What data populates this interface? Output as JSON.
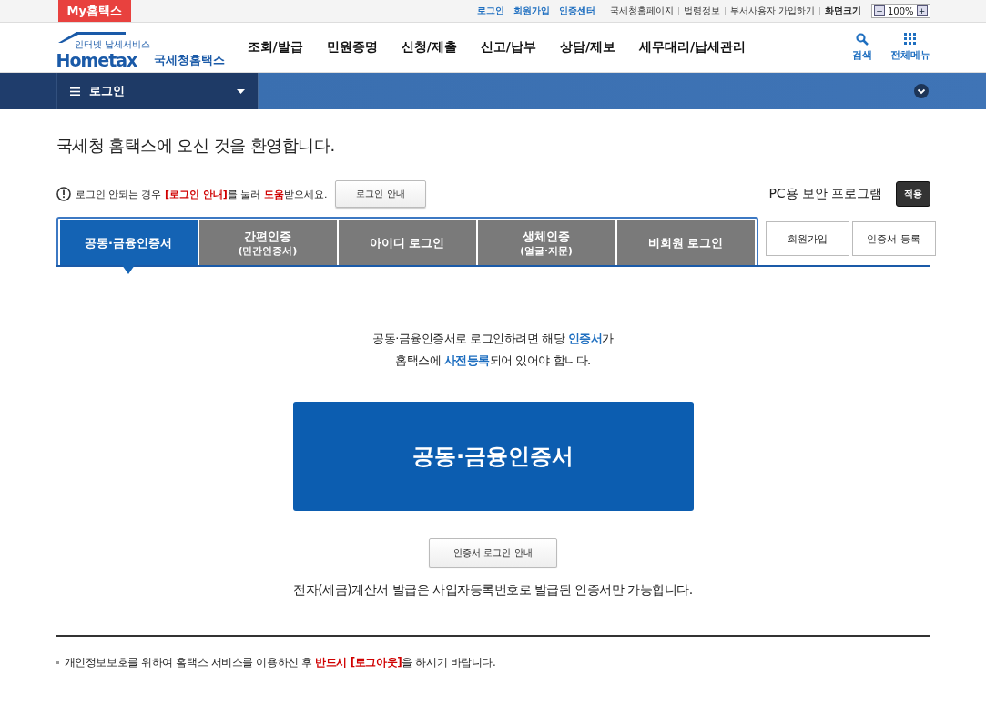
{
  "top_bar": {
    "my_button": "My홈택스",
    "links": [
      {
        "label": "로그인",
        "kind": "primary"
      },
      {
        "label": "회원가입",
        "kind": "primary"
      },
      {
        "label": "인증센터",
        "kind": "primary"
      },
      {
        "label": "국세청홈페이지",
        "kind": "plain"
      },
      {
        "label": "법령정보",
        "kind": "plain"
      },
      {
        "label": "부서사용자 가입하기",
        "kind": "plain"
      },
      {
        "label": "화면크기",
        "kind": "bold"
      }
    ],
    "zoom": {
      "minus": "−",
      "value": "100%",
      "plus": "+"
    }
  },
  "header": {
    "logo": {
      "tagline": "인터넷 납세서비스",
      "brand": "Hometax",
      "name": "국세청홈택스"
    },
    "nav": [
      "조회/발급",
      "민원증명",
      "신청/제출",
      "신고/납부",
      "상담/제보",
      "세무대리/납세관리"
    ],
    "tools": [
      {
        "label": "검색",
        "kind": "search"
      },
      {
        "label": "전체메뉴",
        "kind": "menu"
      }
    ]
  },
  "breadcrumb": {
    "label": "로그인"
  },
  "welcome": "국세청 홈택스에 오신 것을 환영합니다.",
  "help": {
    "text": "로그인 안되는 경우 **[로그인 안내]**를 눌러 **도움**받으세요.",
    "button": "로그인 안내"
  },
  "security": {
    "label": "PC용 보안 프로그램",
    "button": "적용"
  },
  "tabs": [
    {
      "label": "공동·금융인증서",
      "selected": true
    },
    {
      "label": "간편인증",
      "sub": "(민간인증서)",
      "selected": false
    },
    {
      "label": "아이디 로그인",
      "selected": false
    },
    {
      "label": "생체인증",
      "sub": "(얼굴·지문)",
      "selected": false
    },
    {
      "label": "비회원 로그인",
      "selected": false
    }
  ],
  "side_buttons": [
    "회원가입",
    "인증서 등록"
  ],
  "message": [
    "공동·금융인증서로 로그인하려면 해당 **인증서**가",
    "홈택스에 **사전등록**되어 있어야 합니다."
  ],
  "main_button": "공동·금융인증서",
  "guide_button": "인증서 로그인 안내",
  "note": "전자(세금)계산서 발급은 사업자등록번호로 발급된 인증서만 가능합니다.",
  "footer_note": "개인정보보호를 위하여 홈택스 서비스를 이용하신 후 **반드시 [로그아웃]**을 하시기 바랍니다."
}
